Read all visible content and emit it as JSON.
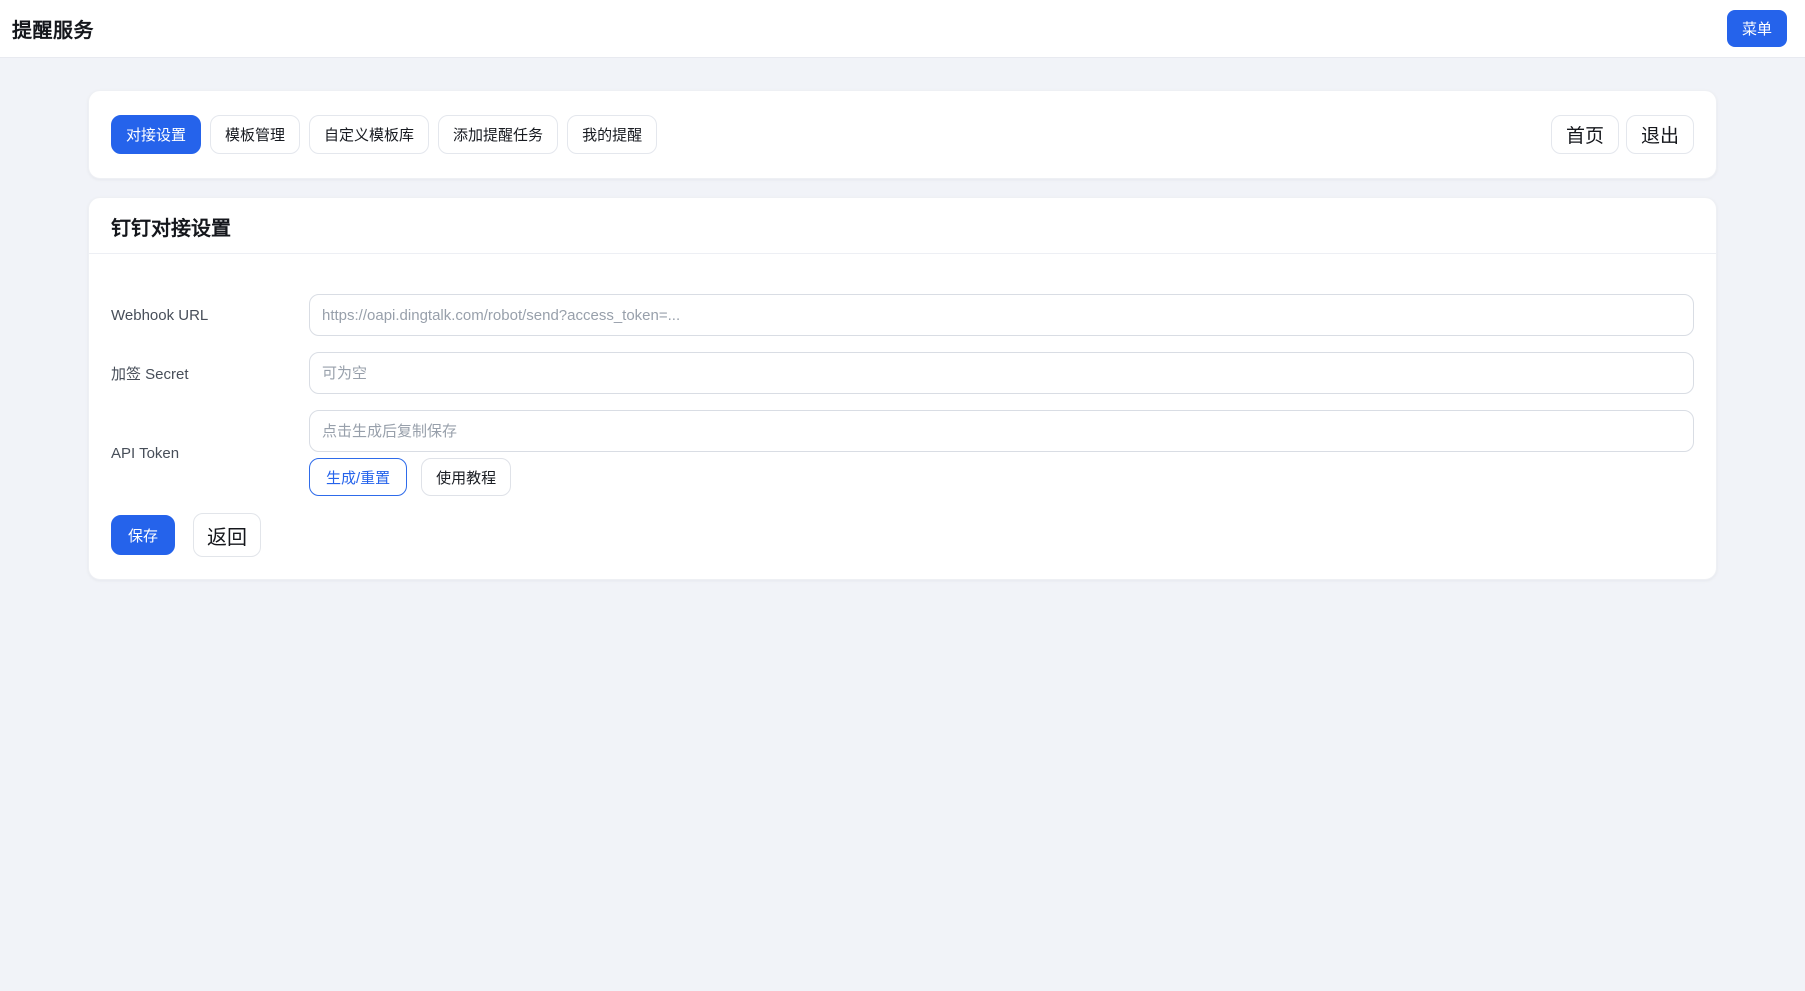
{
  "colors": {
    "accent": "#2563eb",
    "page_bg": "#f1f3f8"
  },
  "header": {
    "title": "提醒服务",
    "menu_button": "菜单"
  },
  "nav": {
    "tabs": [
      {
        "label": "对接设置",
        "active": true
      },
      {
        "label": "模板管理",
        "active": false
      },
      {
        "label": "自定义模板库",
        "active": false
      },
      {
        "label": "添加提醒任务",
        "active": false
      },
      {
        "label": "我的提醒",
        "active": false
      }
    ],
    "links": [
      {
        "label": "首页"
      },
      {
        "label": "退出"
      }
    ]
  },
  "settings": {
    "title": "钉钉对接设置",
    "fields": [
      {
        "label": "Webhook URL",
        "value": "",
        "placeholder": "https://oapi.dingtalk.com/robot/send?access_token=..."
      },
      {
        "label": "加签 Secret",
        "value": "",
        "placeholder": "可为空"
      },
      {
        "label": "API Token",
        "value": "",
        "placeholder": "点击生成后复制保存"
      }
    ],
    "token_buttons": {
      "generate": "生成/重置",
      "tutorial": "使用教程"
    },
    "actions": {
      "save": "保存",
      "back": "返回"
    }
  }
}
